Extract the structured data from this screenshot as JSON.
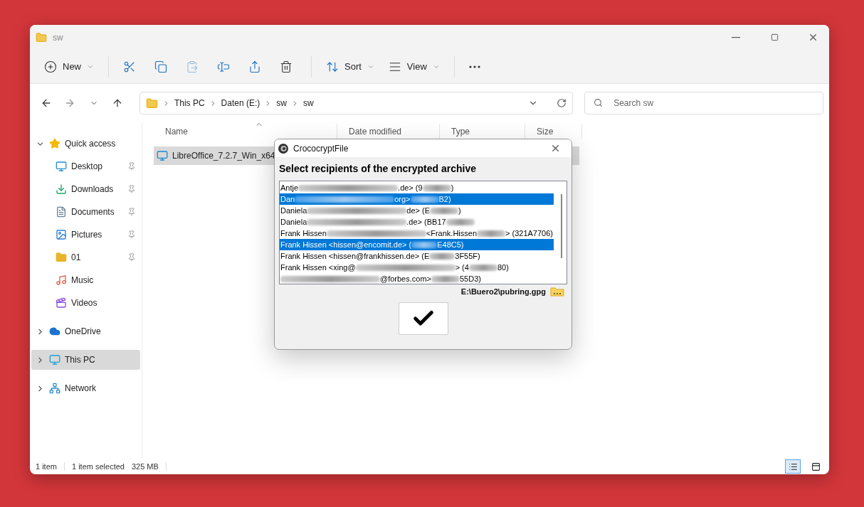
{
  "window": {
    "title": "sw"
  },
  "toolbar": [
    {
      "kind": "new",
      "label": "New",
      "disabled": false
    },
    {
      "kind": "separator"
    },
    {
      "kind": "cut",
      "disabled": false
    },
    {
      "kind": "copy",
      "disabled": false
    },
    {
      "kind": "paste",
      "disabled": true
    },
    {
      "kind": "rename",
      "disabled": false
    },
    {
      "kind": "share",
      "disabled": false
    },
    {
      "kind": "delete",
      "disabled": false
    },
    {
      "kind": "separator"
    },
    {
      "kind": "sort",
      "label": "Sort",
      "disabled": false
    },
    {
      "kind": "view",
      "label": "View",
      "disabled": false
    },
    {
      "kind": "separator"
    },
    {
      "kind": "more",
      "disabled": false
    }
  ],
  "address": {
    "crumbs": [
      "This PC",
      "Daten (E:)",
      "sw",
      "sw"
    ]
  },
  "search": {
    "placeholder": "Search sw"
  },
  "sidebar": {
    "items": [
      {
        "kind": "star",
        "label": "Quick access",
        "expanded": true,
        "selected": false,
        "children": [
          {
            "kind": "desktop",
            "label": "Desktop",
            "pinned": true
          },
          {
            "kind": "downloads",
            "label": "Downloads",
            "pinned": true
          },
          {
            "kind": "documents",
            "label": "Documents",
            "pinned": true
          },
          {
            "kind": "pictures",
            "label": "Pictures",
            "pinned": true
          },
          {
            "kind": "folder",
            "label": "01",
            "pinned": true
          },
          {
            "kind": "music",
            "label": "Music",
            "pinned": false
          },
          {
            "kind": "videos",
            "label": "Videos",
            "pinned": false
          }
        ]
      },
      {
        "kind": "cloud",
        "label": "OneDrive",
        "expanded": false,
        "selected": false
      },
      {
        "kind": "pc",
        "label": "This PC",
        "expanded": false,
        "selected": true
      },
      {
        "kind": "network",
        "label": "Network",
        "expanded": false,
        "selected": false
      }
    ]
  },
  "table": {
    "columns": [
      "Name",
      "Date modified",
      "Type",
      "Size"
    ],
    "rows": [
      {
        "name": "LibreOffice_7.2.7_Win_x64",
        "selected": true
      }
    ]
  },
  "status_bar": {
    "count": "1 item",
    "selection": "1 item selected",
    "size": "325 MB",
    "views": [
      {
        "kind": "details",
        "selected": true
      },
      {
        "kind": "tiles",
        "selected": false
      }
    ]
  },
  "dialog": {
    "title": "CrococryptFile",
    "heading": "Select recipients of the encrypted archive",
    "recipients": [
      {
        "selected": false,
        "segments": [
          {
            "kind": "text",
            "text": "Antje"
          },
          {
            "kind": "redacted"
          },
          {
            "kind": "text",
            "text": ".de> (9"
          },
          {
            "kind": "redacted"
          },
          {
            "kind": "text",
            "text": ")"
          }
        ]
      },
      {
        "selected": true,
        "segments": [
          {
            "kind": "text",
            "text": "Dan"
          },
          {
            "kind": "redacted"
          },
          {
            "kind": "text",
            "text": "org>"
          },
          {
            "kind": "redacted"
          },
          {
            "kind": "text",
            "text": "B2)"
          }
        ]
      },
      {
        "selected": false,
        "segments": [
          {
            "kind": "text",
            "text": "Daniela"
          },
          {
            "kind": "redacted"
          },
          {
            "kind": "text",
            "text": "de> (E"
          },
          {
            "kind": "redacted"
          },
          {
            "kind": "text",
            "text": ")"
          }
        ]
      },
      {
        "selected": false,
        "segments": [
          {
            "kind": "text",
            "text": "Daniela"
          },
          {
            "kind": "redacted"
          },
          {
            "kind": "text",
            "text": ".de> (BB17"
          },
          {
            "kind": "redacted"
          }
        ]
      },
      {
        "selected": false,
        "segments": [
          {
            "kind": "text",
            "text": "Frank Hissen"
          },
          {
            "kind": "redacted"
          },
          {
            "kind": "text",
            "text": "<Frank.Hissen"
          },
          {
            "kind": "redacted"
          },
          {
            "kind": "text",
            "text": "> (321A7706)"
          }
        ]
      },
      {
        "selected": true,
        "segments": [
          {
            "kind": "text",
            "text": "Frank Hissen <hissen@encomit.de> ("
          },
          {
            "kind": "redacted"
          },
          {
            "kind": "text",
            "text": "E48C5)"
          }
        ]
      },
      {
        "selected": false,
        "segments": [
          {
            "kind": "text",
            "text": "Frank Hissen <hissen@frankhissen.de> (E"
          },
          {
            "kind": "redacted"
          },
          {
            "kind": "text",
            "text": "3F55F)"
          }
        ]
      },
      {
        "selected": false,
        "segments": [
          {
            "kind": "text",
            "text": "Frank Hissen <xing@"
          },
          {
            "kind": "redacted"
          },
          {
            "kind": "text",
            "text": "> (4"
          },
          {
            "kind": "redacted"
          },
          {
            "kind": "text",
            "text": "80)"
          }
        ]
      },
      {
        "selected": false,
        "segments": [
          {
            "kind": "redacted"
          },
          {
            "kind": "text",
            "text": "@forbes.com>"
          },
          {
            "kind": "redacted"
          },
          {
            "kind": "text",
            "text": "55D3)"
          }
        ]
      }
    ],
    "keyring": "E:\\Buero2\\pubring.gpg"
  }
}
